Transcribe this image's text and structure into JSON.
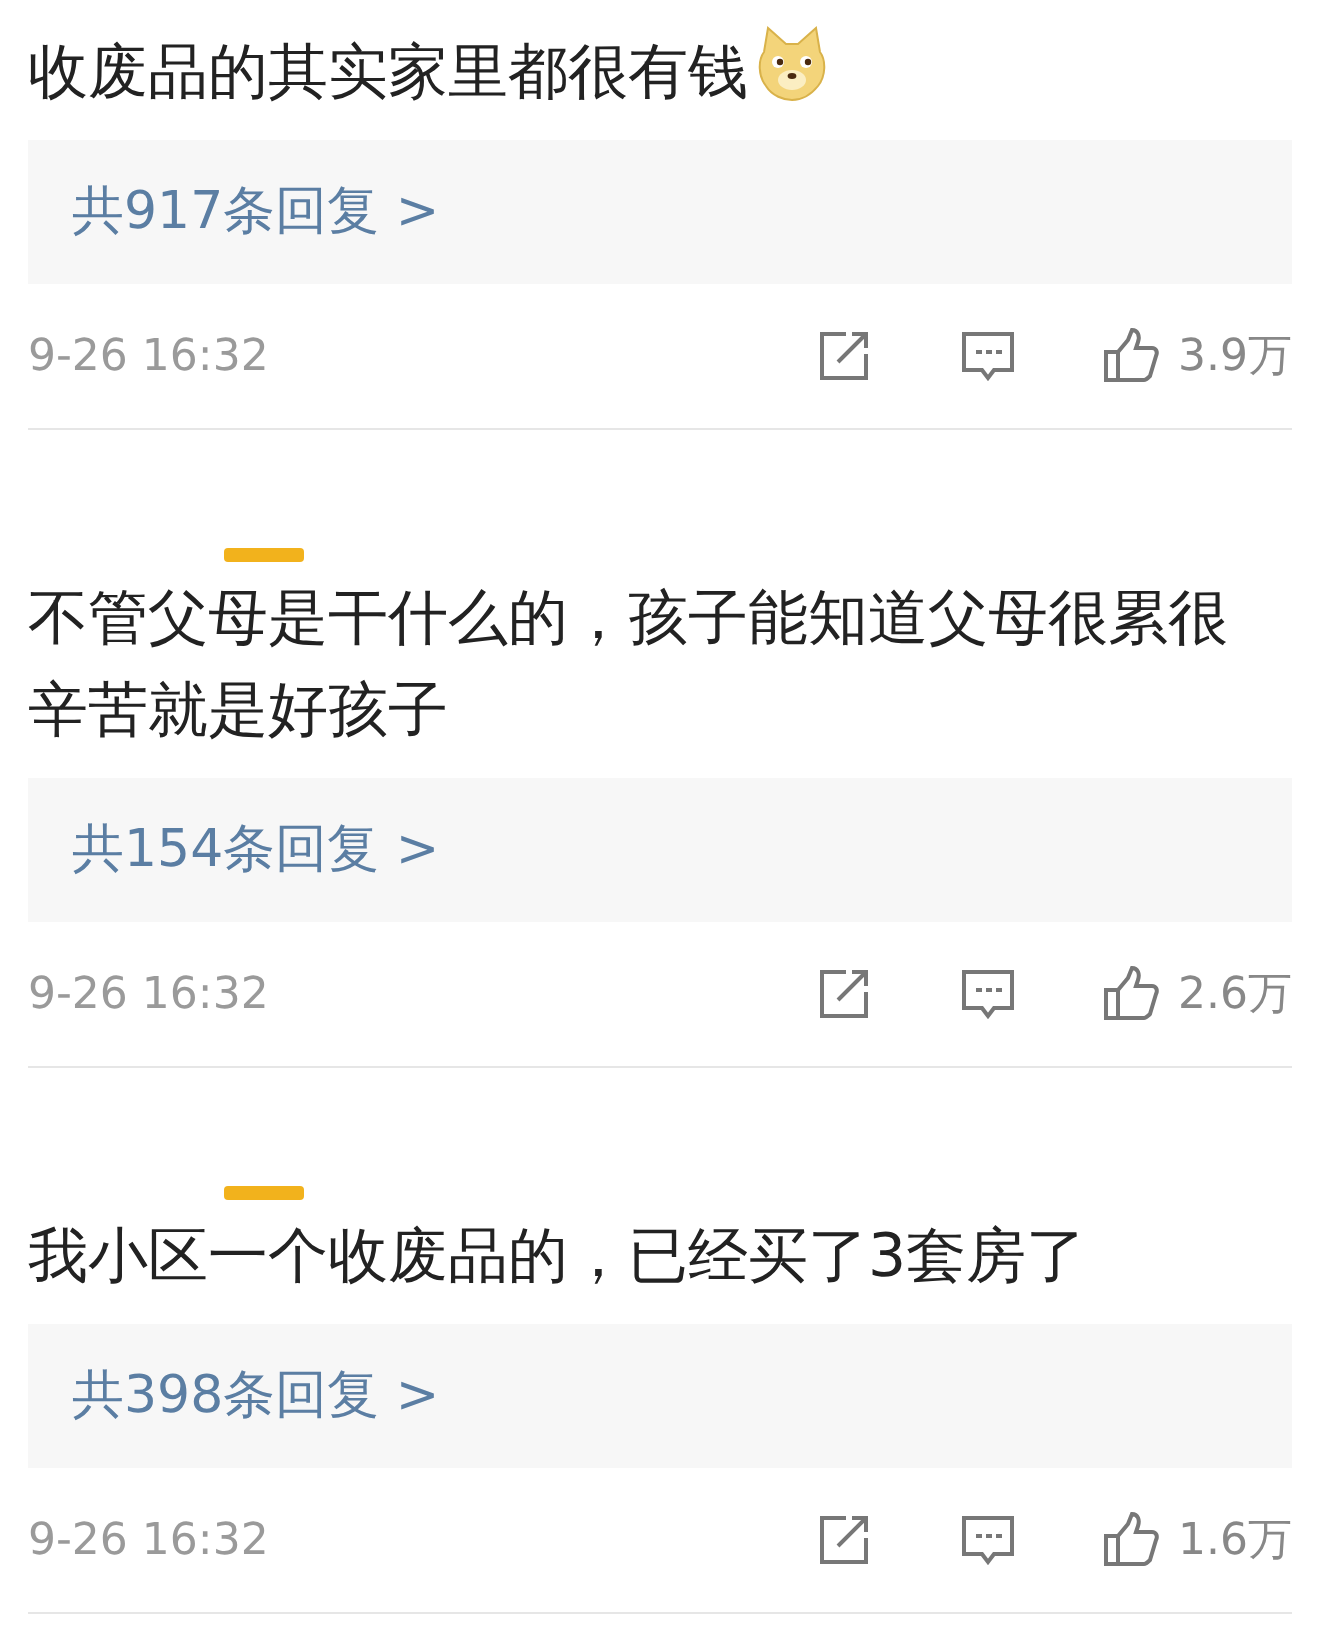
{
  "comments": [
    {
      "has_badge": false,
      "text": "收废品的其实家里都很有钱",
      "emoji": true,
      "replies": "共917条回复 >",
      "time": "9-26 16:32",
      "likes": "3.9万"
    },
    {
      "has_badge": true,
      "text": "不管父母是干什么的，孩子能知道父母很累很辛苦就是好孩子",
      "emoji": false,
      "replies": "共154条回复 >",
      "time": "9-26 16:32",
      "likes": "2.6万"
    },
    {
      "has_badge": true,
      "text": "我小区一个收废品的，已经买了3套房了",
      "emoji": false,
      "replies": "共398条回复 >",
      "time": "9-26 16:32",
      "likes": "1.6万"
    }
  ]
}
